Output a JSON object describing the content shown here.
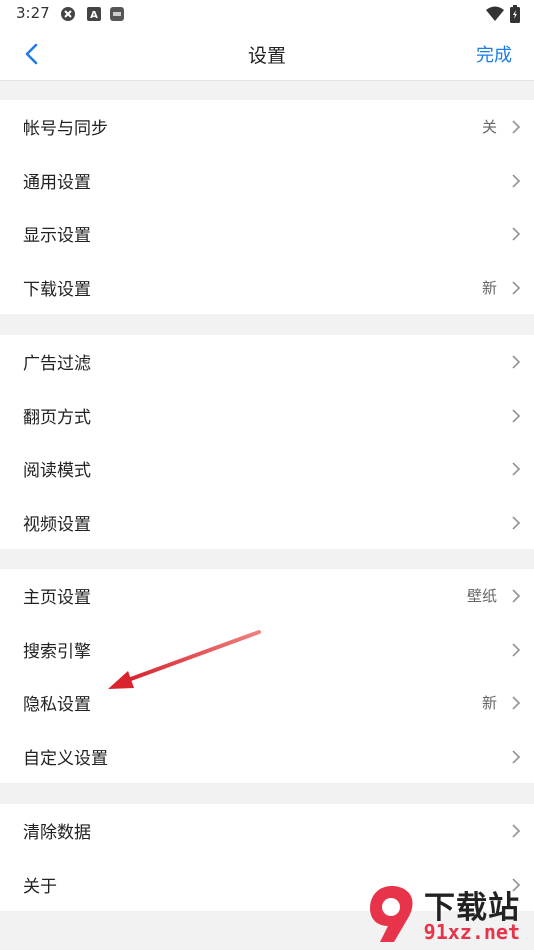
{
  "status_bar": {
    "time": "3:27",
    "icons": [
      "app-badge-icon",
      "a-badge-icon",
      "nfc-badge-icon",
      "wifi-icon",
      "battery-icon"
    ],
    "badge_a": "A"
  },
  "header": {
    "title": "设置",
    "done_label": "完成",
    "accent_color": "#1f7ce8"
  },
  "groups": [
    {
      "items": [
        {
          "label": "帐号与同步",
          "value": "关"
        },
        {
          "label": "通用设置",
          "value": ""
        },
        {
          "label": "显示设置",
          "value": ""
        },
        {
          "label": "下载设置",
          "value": "新"
        }
      ]
    },
    {
      "items": [
        {
          "label": "广告过滤",
          "value": ""
        },
        {
          "label": "翻页方式",
          "value": ""
        },
        {
          "label": "阅读模式",
          "value": ""
        },
        {
          "label": "视频设置",
          "value": ""
        }
      ]
    },
    {
      "items": [
        {
          "label": "主页设置",
          "value": "壁纸"
        },
        {
          "label": "搜索引擎",
          "value": ""
        },
        {
          "label": "隐私设置",
          "value": "新"
        },
        {
          "label": "自定义设置",
          "value": ""
        }
      ]
    },
    {
      "items": [
        {
          "label": "清除数据",
          "value": ""
        },
        {
          "label": "关于",
          "value": ""
        }
      ]
    }
  ],
  "annotation": {
    "color": "#d9232d"
  },
  "watermark": {
    "top_text": "下载站",
    "bottom_text": "91xz.net",
    "color": "#e8344a"
  }
}
